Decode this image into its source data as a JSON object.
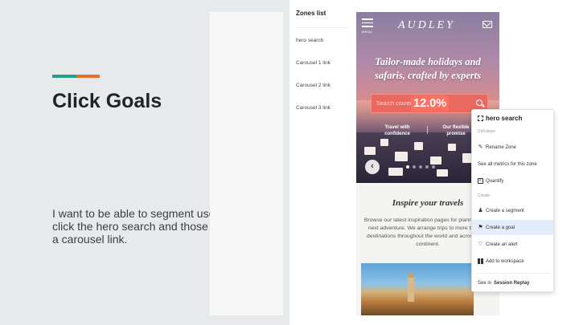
{
  "slide": {
    "title": "Click Goals",
    "body": "I want to be able to segment users who click the hero search and those who click a carousel link.",
    "accent_colors": [
      "#2a9d8f",
      "#e76f2a"
    ]
  },
  "zones": {
    "title": "Zones list",
    "items": [
      "hero search",
      "Carousel 1 link",
      "Carousel 2 link",
      "Carousel 3 link"
    ]
  },
  "site": {
    "menu_label": "MENU",
    "logo": "AUDLEY",
    "headline": [
      "Tailor-made holidays and",
      "safaris, crafted by experts"
    ],
    "search_placeholder": "Search countries or hotels",
    "click_percentage": "12.0%",
    "pills": [
      "Travel with confidence",
      "Our flexible promise"
    ],
    "inspire_title": "Inspire your travels",
    "inspire_text": "Browse our latest inspiration pages for planning your next adventure. We arrange trips to more than 80 destinations throughout the world and across each continent."
  },
  "context_menu": {
    "header": "hero search",
    "drill_down_label": "Drill down",
    "rename": "Rename Zone",
    "see_all_metrics": "See all metrics for this zone",
    "quantify": "Quantify",
    "create_label": "Create",
    "create_segment": "Create a segment",
    "create_goal": "Create a goal",
    "create_alert": "Create an alert",
    "add_workspace": "Add to workspace",
    "see_in": "See in",
    "session_replay": "Session Replay"
  },
  "icons": {
    "zone": "focus-icon",
    "rename": "pencil-icon",
    "quantify": "calculator-icon",
    "segment": "users-icon",
    "goal": "flag-icon",
    "alert": "bell-icon",
    "workspace": "grid-icon",
    "menu": "hamburger-icon",
    "mail": "mail-icon",
    "search": "search-icon",
    "prev": "chevron-left-icon"
  }
}
